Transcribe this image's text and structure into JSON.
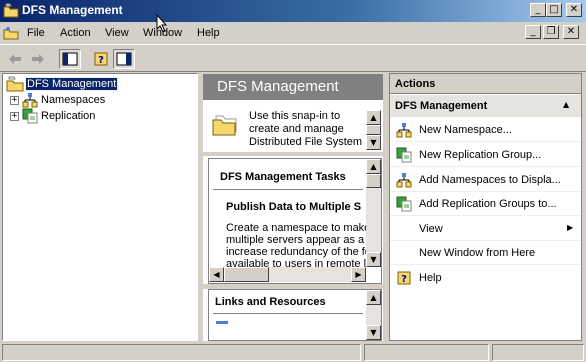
{
  "window": {
    "title": "DFS Management"
  },
  "menubar": {
    "items": [
      "File",
      "Action",
      "View",
      "Window",
      "Help"
    ]
  },
  "tree": {
    "root": "DFS Management",
    "children": [
      "Namespaces",
      "Replication"
    ]
  },
  "center": {
    "title": "DFS Management",
    "intro": [
      "Use this snap-in to",
      "create and manage",
      "Distributed File System"
    ],
    "tasks_title": "DFS Management Tasks",
    "task_heading": "Publish Data to Multiple S",
    "task_body": [
      "Create a namespace to make",
      "multiple servers appear as a s",
      "increase redundancy of the fo",
      "available to users in remote lo"
    ],
    "links_title": "Links and Resources"
  },
  "actions": {
    "title": "Actions",
    "group": "DFS Management",
    "items": [
      {
        "label": "New Namespace...",
        "icon": "namespace-icon"
      },
      {
        "label": "New Replication Group...",
        "icon": "replication-icon"
      },
      {
        "label": "Add Namespaces to Displa...",
        "icon": "namespace-icon"
      },
      {
        "label": "Add Replication Groups to...",
        "icon": "replication-icon"
      },
      {
        "label": "View",
        "icon": "none"
      },
      {
        "label": "New Window from Here",
        "icon": "none"
      },
      {
        "label": "Help",
        "icon": "help-icon"
      }
    ]
  }
}
